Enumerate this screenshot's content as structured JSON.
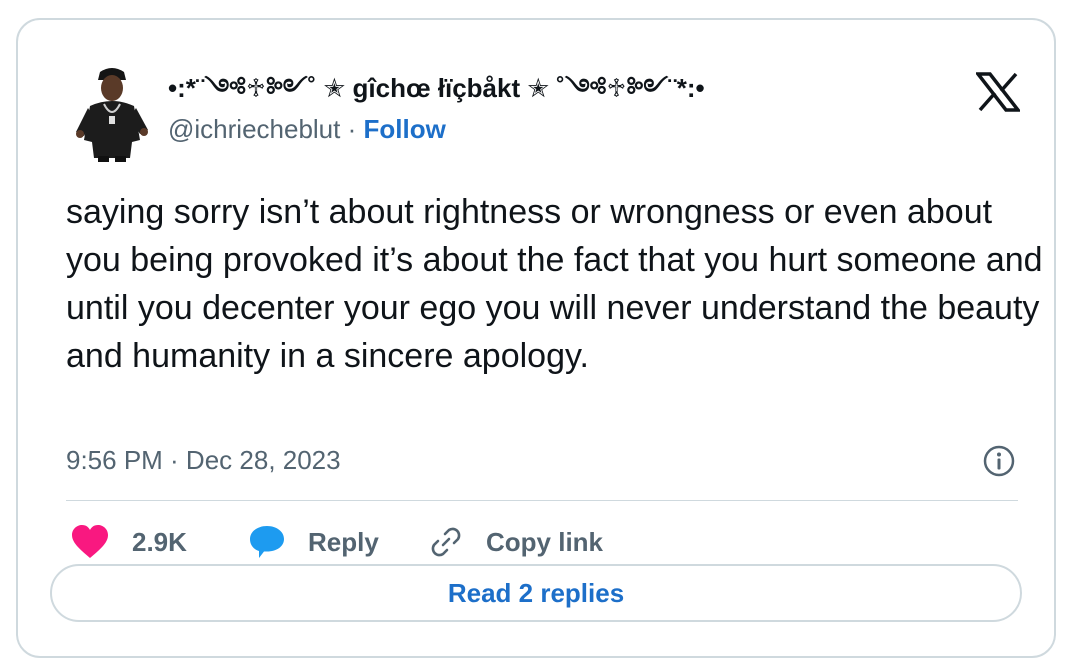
{
  "author": {
    "display_name": "•:*¨༺♱༻˚ ✭ gîchœ łïçbåkt ✭ ˚༺♱༻¨*:•",
    "handle": "@ichriecheblut",
    "separator": "·",
    "follow_label": "Follow",
    "avatar_icon": "person-avatar-icon"
  },
  "brand": {
    "logo_icon": "x-logo-icon"
  },
  "tweet": {
    "text": "saying sorry isn’t about rightness or wrongness or even about you being provoked it’s about the fact that you hurt someone and until you decenter your ego you will never understand the beauty and humanity in a sincere apology.",
    "timestamp": "9:56 PM · Dec 28, 2023"
  },
  "actions": {
    "like_count": "2.9K",
    "reply_label": "Reply",
    "copy_link_label": "Copy link",
    "read_replies_label": "Read 2 replies"
  },
  "colors": {
    "heart": "#f91880",
    "reply_bubble": "#1d9bf0",
    "link_blue": "#1d6fc9",
    "muted": "#536471",
    "border": "#cfd9de"
  }
}
